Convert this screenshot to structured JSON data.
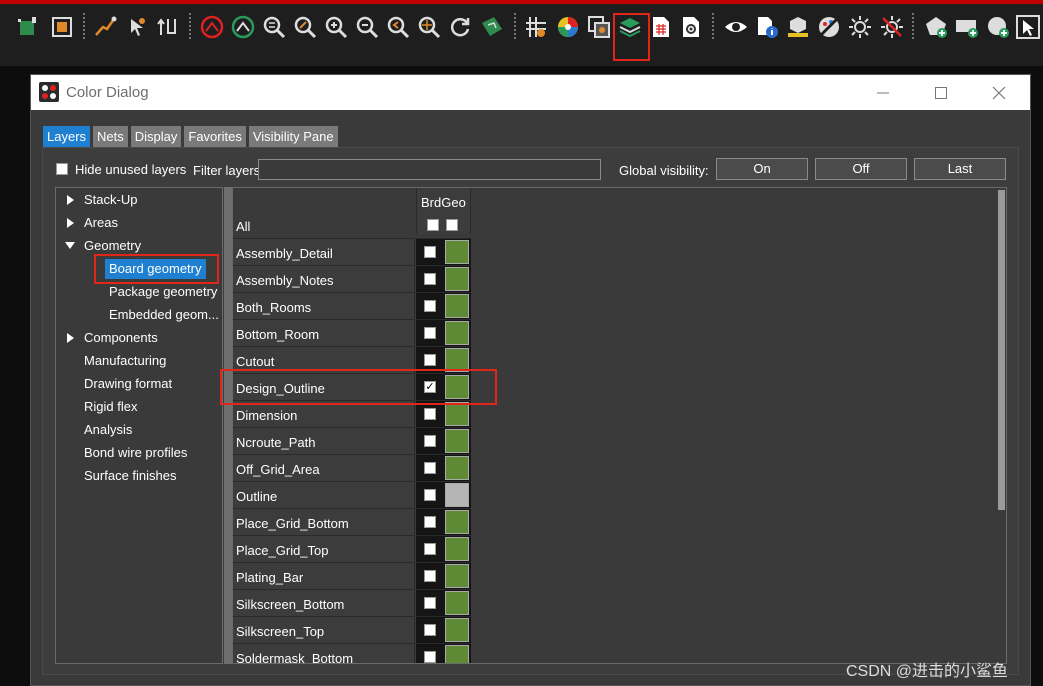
{
  "dialog": {
    "title": "Color Dialog",
    "tabs": [
      {
        "label": "Layers",
        "active": true
      },
      {
        "label": "Nets",
        "active": false
      },
      {
        "label": "Display",
        "active": false
      },
      {
        "label": "Favorites",
        "active": false
      },
      {
        "label": "Visibility Pane",
        "active": false
      }
    ],
    "hide_unused_label": "Hide unused layers",
    "filter_label": "Filter layers:",
    "filter_value": "",
    "global_visibility_label": "Global visibility:",
    "buttons": {
      "on": "On",
      "off": "Off",
      "last": "Last"
    }
  },
  "tree": [
    {
      "label": "Stack-Up",
      "expander": "collapsed",
      "level": 0
    },
    {
      "label": "Areas",
      "expander": "collapsed",
      "level": 0
    },
    {
      "label": "Geometry",
      "expander": "expanded",
      "level": 0
    },
    {
      "label": "Board geometry",
      "expander": "none",
      "level": 1,
      "selected": true
    },
    {
      "label": "Package geometry",
      "expander": "none",
      "level": 1
    },
    {
      "label": "Embedded geom...",
      "expander": "none",
      "level": 1
    },
    {
      "label": "Components",
      "expander": "collapsed",
      "level": 0
    },
    {
      "label": "Manufacturing",
      "expander": "none",
      "level": 0
    },
    {
      "label": "Drawing format",
      "expander": "none",
      "level": 0
    },
    {
      "label": "Rigid flex",
      "expander": "none",
      "level": 0
    },
    {
      "label": "Analysis",
      "expander": "none",
      "level": 0
    },
    {
      "label": "Bond wire profiles",
      "expander": "none",
      "level": 0
    },
    {
      "label": "Surface finishes",
      "expander": "none",
      "level": 0
    }
  ],
  "grid": {
    "column_header": "BrdGeo",
    "all_label": "All",
    "rows": [
      {
        "name": "Assembly_Detail",
        "checked": false,
        "color": "#5f8a35"
      },
      {
        "name": "Assembly_Notes",
        "checked": false,
        "color": "#5f8a35"
      },
      {
        "name": "Both_Rooms",
        "checked": false,
        "color": "#5f8a35"
      },
      {
        "name": "Bottom_Room",
        "checked": false,
        "color": "#5f8a35"
      },
      {
        "name": "Cutout",
        "checked": false,
        "color": "#5f8a35"
      },
      {
        "name": "Design_Outline",
        "checked": true,
        "color": "#5f8a35"
      },
      {
        "name": "Dimension",
        "checked": false,
        "color": "#5f8a35"
      },
      {
        "name": "Ncroute_Path",
        "checked": false,
        "color": "#5f8a35"
      },
      {
        "name": "Off_Grid_Area",
        "checked": false,
        "color": "#5f8a35"
      },
      {
        "name": "Outline",
        "checked": false,
        "color": "#b5b5b5"
      },
      {
        "name": "Place_Grid_Bottom",
        "checked": false,
        "color": "#5f8a35"
      },
      {
        "name": "Place_Grid_Top",
        "checked": false,
        "color": "#5f8a35"
      },
      {
        "name": "Plating_Bar",
        "checked": false,
        "color": "#5f8a35"
      },
      {
        "name": "Silkscreen_Bottom",
        "checked": false,
        "color": "#5f8a35"
      },
      {
        "name": "Silkscreen_Top",
        "checked": false,
        "color": "#5f8a35"
      },
      {
        "name": "Soldermask_Bottom",
        "checked": false,
        "color": "#5f8a35"
      }
    ]
  },
  "toolbar_icons": [
    "chip-icon",
    "cpu-icon",
    "route-icon",
    "pointer-move-icon",
    "swap-icon",
    "drc-icon",
    "drc-alt-icon",
    "zoom-fit-icon",
    "zoom-window-icon",
    "zoom-in-icon",
    "zoom-out-icon",
    "zoom-prev-icon",
    "zoom-center-icon",
    "redraw-icon",
    "board-3d-icon",
    "grid-icon",
    "color-wheel-icon",
    "shadow-mode-icon",
    "layer-color-icon",
    "spreadsheet-icon",
    "settings-doc-icon",
    "visibility-eye-icon",
    "info-doc-icon",
    "ruler-box-icon",
    "palette-off-icon",
    "light-icon",
    "light-off-icon",
    "add-shape-icon",
    "add-rect-icon",
    "add-circle-icon",
    "select-arrow-icon"
  ],
  "watermark": "CSDN @进击的小鲨鱼",
  "colors": {
    "accent": "#1f7fd0",
    "highlight": "#e0261a",
    "swatch_green": "#5f8a35"
  }
}
